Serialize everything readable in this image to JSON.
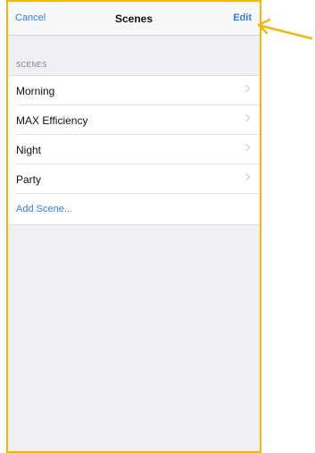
{
  "nav": {
    "cancel_label": "Cancel",
    "title": "Scenes",
    "edit_label": "Edit"
  },
  "section": {
    "header": "SCENES",
    "items": [
      {
        "label": "Morning"
      },
      {
        "label": "MAX Efficiency"
      },
      {
        "label": "Night"
      },
      {
        "label": "Party"
      }
    ],
    "add_label": "Add Scene..."
  },
  "colors": {
    "accent": "#2f7fe0",
    "highlight_border": "#f5b50f",
    "annotation_arrow": "#f5b50f"
  },
  "icons": {
    "row_disclosure": "chevron-right-icon",
    "annotation": "arrow-left-icon"
  }
}
